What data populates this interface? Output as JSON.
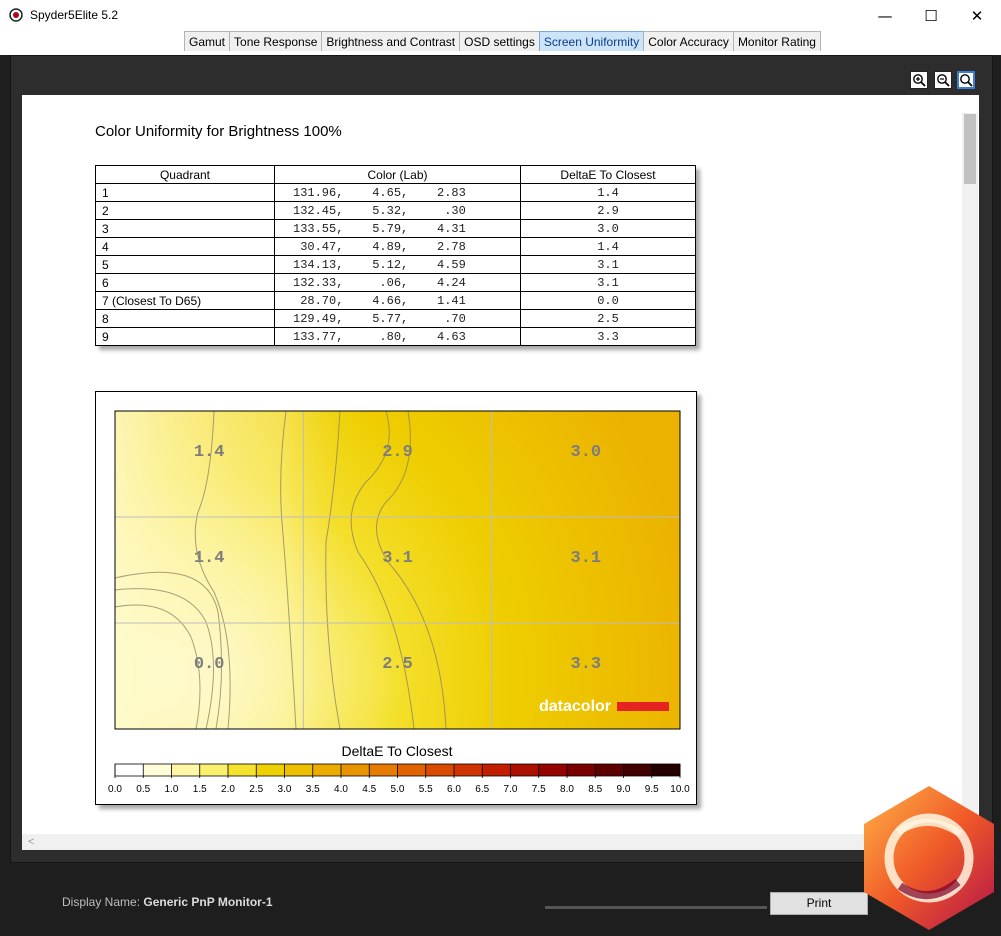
{
  "window": {
    "title": "Spyder5Elite 5.2",
    "minimize": "—",
    "maximize": "☐",
    "close": "✕"
  },
  "tabs": [
    {
      "label": "Gamut",
      "active": false
    },
    {
      "label": "Tone Response",
      "active": false
    },
    {
      "label": "Brightness and Contrast",
      "active": false
    },
    {
      "label": "OSD settings",
      "active": false
    },
    {
      "label": "Screen Uniformity",
      "active": true
    },
    {
      "label": "Color Accuracy",
      "active": false
    },
    {
      "label": "Monitor Rating",
      "active": false
    }
  ],
  "zoom_tools": [
    "zoom-in-icon",
    "zoom-out-icon",
    "zoom-fit-icon"
  ],
  "report": {
    "title": "Color Uniformity for Brightness 100%",
    "headers": [
      "Quadrant",
      "Color (Lab)",
      "DeltaE To Closest"
    ],
    "rows": [
      {
        "q": "1",
        "lab": "131.96,    4.65,    2.83",
        "de": "1.4"
      },
      {
        "q": "2",
        "lab": "132.45,    5.32,     .30",
        "de": "2.9"
      },
      {
        "q": "3",
        "lab": "133.55,    5.79,    4.31",
        "de": "3.0"
      },
      {
        "q": "4",
        "lab": " 30.47,    4.89,    2.78",
        "de": "1.4"
      },
      {
        "q": "5",
        "lab": "134.13,    5.12,    4.59",
        "de": "3.1"
      },
      {
        "q": "6",
        "lab": "132.33,     .06,    4.24",
        "de": "3.1"
      },
      {
        "q": "7 (Closest To D65)",
        "lab": " 28.70,    4.66,    1.41",
        "de": "0.0"
      },
      {
        "q": "8",
        "lab": "129.49,    5.77,     .70",
        "de": "2.5"
      },
      {
        "q": "9",
        "lab": "133.77,     .80,    4.63",
        "de": "3.3"
      }
    ]
  },
  "chart_data": {
    "type": "heatmap",
    "title": "",
    "grid": [
      [
        "1.4",
        "2.9",
        "3.0"
      ],
      [
        "1.4",
        "3.1",
        "3.1"
      ],
      [
        "0.0",
        "2.5",
        "3.3"
      ]
    ],
    "values": [
      [
        1.4,
        2.9,
        3.0
      ],
      [
        1.4,
        3.1,
        3.1
      ],
      [
        0.0,
        2.5,
        3.3
      ]
    ],
    "legend_title": "DeltaE To Closest",
    "legend_ticks": [
      "0.0",
      "0.5",
      "1.0",
      "1.5",
      "2.0",
      "2.5",
      "3.0",
      "3.5",
      "4.0",
      "4.5",
      "5.0",
      "5.5",
      "6.0",
      "6.5",
      "7.0",
      "7.5",
      "8.0",
      "8.5",
      "9.0",
      "9.5",
      "10.0"
    ],
    "legend_range": [
      0,
      10
    ],
    "legend_colors": [
      "#ffffff",
      "#fffcd9",
      "#fff7a6",
      "#fbef6e",
      "#f5e22e",
      "#efd000",
      "#edbf00",
      "#ebab00",
      "#e89300",
      "#e57b00",
      "#e06300",
      "#d84b00",
      "#cf3300",
      "#c11f00",
      "#ad1000",
      "#950500",
      "#7a0000",
      "#5e0000",
      "#420000",
      "#250000"
    ],
    "watermark": "datacolor"
  },
  "bottom": {
    "display_label": "Display Name:",
    "display_value": "Generic PnP Monitor-1",
    "print_label": "Print"
  }
}
